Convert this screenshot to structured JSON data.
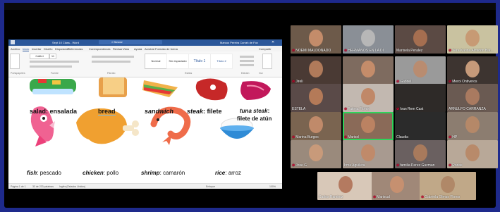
{
  "word": {
    "title": "Sept 10 Class - Word",
    "search_placeholder": "Buscar",
    "user": "Marcus Pereira Currah de Fox",
    "menu": [
      "Archivo",
      "Inicio",
      "Insertar",
      "Diseño",
      "Disposición",
      "Referencias",
      "Correspondencia",
      "Revisar",
      "Vista",
      "Ayuda",
      "Acrobat",
      "Formato de forma"
    ],
    "share": "Compartir",
    "styles": [
      "Normal",
      "Sin espaciado",
      "Título 1",
      "Título 2"
    ],
    "groups": [
      "Portapapeles",
      "Fuente",
      "Párrafo",
      "Estilos",
      "Edición",
      "Voz",
      "Sensibilidad"
    ],
    "font_name": "Calibri",
    "font_size": "11",
    "status": [
      "Página 1 de 1",
      "33 de 233 palabras",
      "Inglés (Estados Unidos)",
      "Accesibilidad: es necesario investigar",
      "Centro de atención",
      "Enfoque",
      "100%"
    ],
    "vocab": [
      {
        "en": "salad",
        "es": "ensalada"
      },
      {
        "en": "bread",
        "es": ""
      },
      {
        "en": "sandwich",
        "es": ""
      },
      {
        "en": "steak",
        "es": "filete"
      },
      {
        "en": "tuna steak",
        "es": "filete de atún"
      },
      {
        "en": "fish",
        "es": "pescado"
      },
      {
        "en": "chicken",
        "es": "pollo"
      },
      {
        "en": "shrimp",
        "es": "camarón"
      },
      {
        "en": "rice",
        "es": "arroz"
      }
    ]
  },
  "participants": [
    {
      "name": "NOEMI MALDONADO"
    },
    {
      "name": "HERMANOS EN LA DI..."
    },
    {
      "name": "Marisela Peralez"
    },
    {
      "name": "Vera Karina Almidón Bar..."
    },
    {
      "name": "Jireli"
    },
    {
      "name": ""
    },
    {
      "name": "Gabriel"
    },
    {
      "name": "Meroi Ontiveros"
    },
    {
      "name": "ESTELA"
    },
    {
      "name": "Fatima Flores"
    },
    {
      "name": "Ivan Rem Cast"
    },
    {
      "name": "ARNULFO CARRANZA"
    },
    {
      "name": "Marina Burgos"
    },
    {
      "name": "Marisol"
    },
    {
      "name": "Claudia"
    },
    {
      "name": "HP"
    },
    {
      "name": "Jose G"
    },
    {
      "name": "Irma Aguilera"
    },
    {
      "name": "familia Perez Guzman"
    },
    {
      "name": "Rodas"
    },
    {
      "name": "Carlos Ramirez"
    },
    {
      "name": "Mariscal"
    },
    {
      "name": "Gabriela Olmos Flores"
    }
  ]
}
